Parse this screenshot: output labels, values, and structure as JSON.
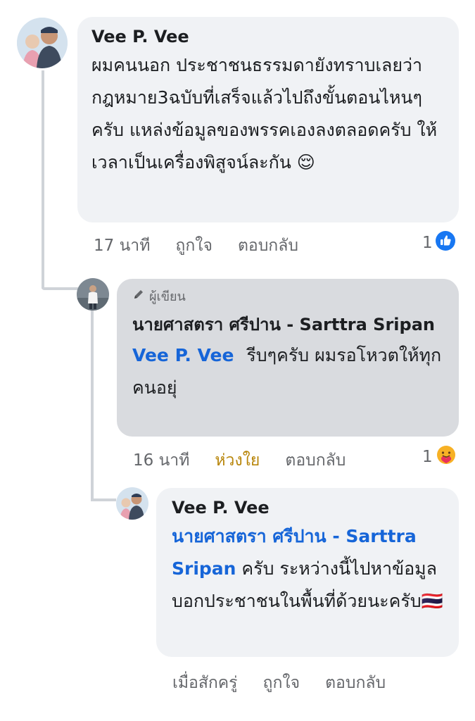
{
  "comments": [
    {
      "author": "Vee P. Vee",
      "text": "ผมคนนอก ประชาชนธรรมดายังทราบเลยว่ากฎหมาย3ฉบับที่เสร็จแล้วไปถึงขั้นตอนไหนๆครับ แหล่งข้อมูลของพรรคเองลงตลอดครับ ให้เวลาเป็นเครื่องพิสูจน์ละกัน",
      "emoji": "😌",
      "time": "17 นาที",
      "like_label": "ถูกใจ",
      "reply_label": "ตอบกลับ",
      "reaction_count": "1",
      "reaction_icon": "like-icon",
      "accent": "#1877f2"
    },
    {
      "badge": "ผู้เขียน",
      "author": "นายศาสตรา ศรีปาน - Sarttra Sripan",
      "mention": "Vee P. Vee",
      "text": "รีบๆครับ ผมรอโหวตให้ทุกคนอยุ่",
      "time": "16 นาที",
      "like_label": "ห่วงใย",
      "like_color": "#b8860b",
      "reply_label": "ตอบกลับ",
      "reaction_count": "1",
      "reaction_icon": "care-icon"
    },
    {
      "author": "Vee P. Vee",
      "mention": "นายศาสตรา ศรีปาน - Sarttra Sripan",
      "text": "ครับ ระหว่างนี้ไปหาข้อมูลบอกประชาชนในพื้นที่ด้วยนะครับ",
      "flag": "🇹🇭",
      "time": "เมื่อสักครู่",
      "like_label": "ถูกใจ",
      "reply_label": "ตอบกลับ"
    }
  ]
}
